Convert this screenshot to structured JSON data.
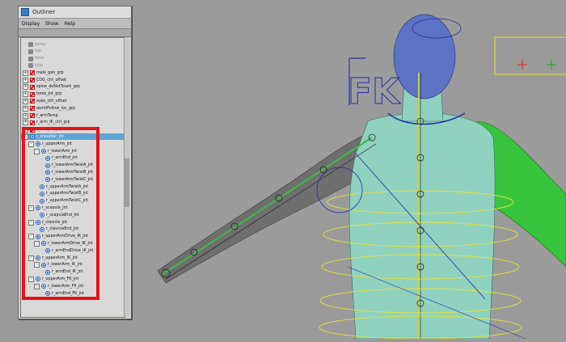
{
  "window": {
    "title": "Outliner"
  },
  "menu": [
    "Display",
    "Show",
    "Help"
  ],
  "tree": [
    {
      "label": "persp",
      "depth": 0,
      "type": "camera",
      "faded": true,
      "exp": ""
    },
    {
      "label": "top",
      "depth": 0,
      "type": "camera",
      "faded": true,
      "exp": ""
    },
    {
      "label": "front",
      "depth": 0,
      "type": "camera",
      "faded": true,
      "exp": ""
    },
    {
      "label": "side",
      "depth": 0,
      "type": "camera",
      "faded": true,
      "exp": ""
    },
    {
      "label": "male_geo_grp",
      "depth": 0,
      "type": "curve",
      "exp": "+"
    },
    {
      "label": "COG_ctrl_offset",
      "depth": 0,
      "type": "curve",
      "exp": "+"
    },
    {
      "label": "spine_doNotTouch_grp",
      "depth": 0,
      "type": "curve",
      "exp": "+"
    },
    {
      "label": "torso_jnt_grp",
      "depth": 0,
      "type": "curve",
      "exp": "+"
    },
    {
      "label": "eyes_ctrl_offset",
      "depth": 0,
      "type": "curve",
      "exp": "+"
    },
    {
      "label": "worldFollow_loc_grp",
      "depth": 0,
      "type": "curve",
      "exp": "+"
    },
    {
      "label": "r_armTemp",
      "depth": 0,
      "type": "curve",
      "exp": "+"
    },
    {
      "label": "r_arm_IK_ctrl_grp",
      "depth": 0,
      "type": "curve",
      "exp": "+"
    },
    {
      "label": "r_arm_fk_grp",
      "depth": 0,
      "type": "curve",
      "exp": "+",
      "faded": true
    },
    {
      "label": "r_shoulder_jnt",
      "depth": 0,
      "type": "joint",
      "exp": "-",
      "selected": true
    },
    {
      "label": "r_upperArm_jnt",
      "depth": 1,
      "type": "joint",
      "exp": "-"
    },
    {
      "label": "r_lowerArm_jnt",
      "depth": 2,
      "type": "joint",
      "exp": "-"
    },
    {
      "label": "r_armEnd_jnt",
      "depth": 3,
      "type": "joint",
      "exp": ""
    },
    {
      "label": "r_lowerArmTwistA_jnt",
      "depth": 3,
      "type": "joint",
      "exp": ""
    },
    {
      "label": "r_lowerArmTwistB_jnt",
      "depth": 3,
      "type": "joint",
      "exp": ""
    },
    {
      "label": "r_lowerArmTwistC_jnt",
      "depth": 3,
      "type": "joint",
      "exp": ""
    },
    {
      "label": "r_upperArmTwistA_jnt",
      "depth": 2,
      "type": "joint",
      "exp": ""
    },
    {
      "label": "r_upperArmTwistB_jnt",
      "depth": 2,
      "type": "joint",
      "exp": ""
    },
    {
      "label": "r_upperArmTwistC_jnt",
      "depth": 2,
      "type": "joint",
      "exp": ""
    },
    {
      "label": "r_scapula_jnt",
      "depth": 1,
      "type": "joint",
      "exp": "-"
    },
    {
      "label": "r_scapulaEnd_jnt",
      "depth": 2,
      "type": "joint",
      "exp": ""
    },
    {
      "label": "r_clavicle_jnt",
      "depth": 1,
      "type": "joint",
      "exp": "-"
    },
    {
      "label": "r_clavicleEnd_jnt",
      "depth": 2,
      "type": "joint",
      "exp": ""
    },
    {
      "label": "r_upperArmDrive_IK_jnt",
      "depth": 1,
      "type": "joint",
      "exp": "-"
    },
    {
      "label": "r_lowerArmDrive_IK_jnt",
      "depth": 2,
      "type": "joint",
      "exp": "-"
    },
    {
      "label": "r_armEndDrive_IK_jnt",
      "depth": 3,
      "type": "joint",
      "exp": ""
    },
    {
      "label": "r_upperArm_IK_jnt",
      "depth": 1,
      "type": "joint",
      "exp": "-"
    },
    {
      "label": "r_lowerArm_IK_jnt",
      "depth": 2,
      "type": "joint",
      "exp": "-"
    },
    {
      "label": "r_armEnd_IK_jnt",
      "depth": 3,
      "type": "joint",
      "exp": ""
    },
    {
      "label": "r_upperArm_FK_jnt",
      "depth": 1,
      "type": "joint",
      "exp": "-"
    },
    {
      "label": "r_lowerArm_FK_jnt",
      "depth": 2,
      "type": "joint",
      "exp": "-"
    },
    {
      "label": "r_armEnd_FK_jnt",
      "depth": 3,
      "type": "joint",
      "exp": ""
    }
  ],
  "viewport": {
    "fk_label": "FK"
  }
}
